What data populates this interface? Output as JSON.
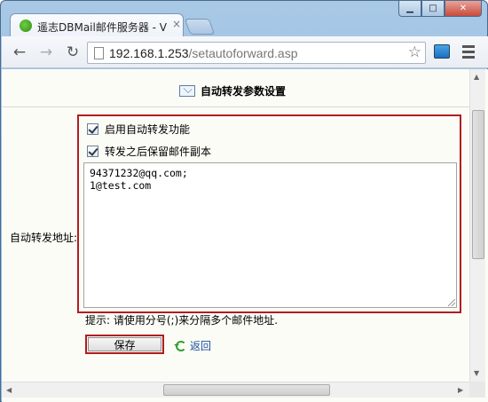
{
  "browser": {
    "tab_title": "遥志DBMail邮件服务器 - V",
    "tab_close": "×",
    "url_host": "192.168.1.253",
    "url_path": "/setautoforward.asp",
    "window_buttons": {
      "minimize": "▁",
      "maximize": "□",
      "close": "✕"
    },
    "nav": {
      "back": "←",
      "forward": "→",
      "reload": "↻"
    },
    "icons": {
      "star": "star-icon",
      "menu": "menu-icon",
      "extension": "extension-icon"
    }
  },
  "page": {
    "heading": "自动转发参数设置",
    "field_label": "自动转发地址:",
    "options": [
      {
        "label": "启用自动转发功能",
        "checked": true
      },
      {
        "label": "转发之后保留邮件副本",
        "checked": true
      }
    ],
    "addresses": "94371232@qq.com;\n1@test.com",
    "hint": "提示: 请使用分号(;)来分隔多个邮件地址.",
    "save_label": "保存",
    "back_label": "返回"
  },
  "colors": {
    "highlight_border": "#b01e1e",
    "link": "#1a4fa0"
  }
}
